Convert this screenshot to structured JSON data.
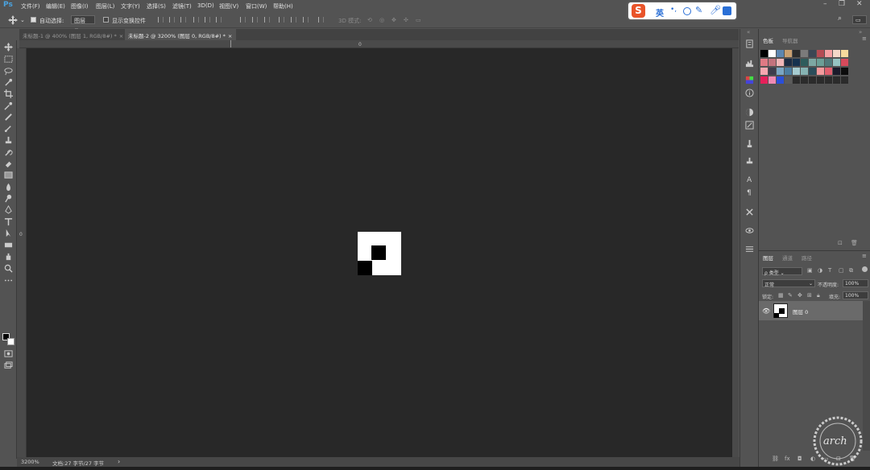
{
  "menubar": {
    "logo": "Ps",
    "items": [
      "文件(F)",
      "编辑(E)",
      "图像(I)",
      "图层(L)",
      "文字(Y)",
      "选择(S)",
      "滤镜(T)",
      "3D(D)",
      "视图(V)",
      "窗口(W)",
      "帮助(H)"
    ]
  },
  "options": {
    "auto_select_label": "自动选择:",
    "auto_select_value": "图层",
    "show_transform_label": "显示变换控件",
    "mode_3d_label": "3D 模式:"
  },
  "ime": {
    "lang": "英",
    "punct": "•,"
  },
  "tabs": [
    {
      "label": "未标题-1 @ 400% (图层 1, RGB/8#) *",
      "close": "×"
    },
    {
      "label": "未标题-2 @ 3200% (图层 0, RGB/8#) *",
      "close": "×"
    }
  ],
  "rulers": {
    "top_zero": "0",
    "left_zero": "0"
  },
  "status": {
    "zoom": "3200%",
    "doc_info": "文档:27 字节/27 字节",
    "arrow": "›"
  },
  "swatches_panel": {
    "tab_swatches": "色板",
    "tab_navigator": "导航器",
    "colors": [
      [
        "#000000",
        "#ffffff",
        "#5d86b0",
        "#c9a071",
        "#2b2b2b",
        "#7b7b7b",
        "#3c4654",
        "#b54b54",
        "#f6a1a4",
        "#f3d8c9",
        "#f6d99c"
      ],
      [
        "#e07a84",
        "#c2737d",
        "#f0b7b8",
        "#1d2d44",
        "#16324f",
        "#2e5c5c",
        "#7da7a3",
        "#6b9e96",
        "#50797a",
        "#96c4c2",
        "#d64a5b"
      ],
      [
        "#f7a8b0",
        "#3d3d4c",
        "#7aa6c2",
        "#4c7ea0",
        "#a5cbd0",
        "#86b3b3",
        "#2b4d5a",
        "#f39a9d",
        "#e05f6e",
        "#1a1a2a",
        "#0c0c0c"
      ],
      [
        "#e6205a",
        "#f08ab4",
        "#2b4fd8",
        "#5b5b5b",
        "#2b2b2b",
        "#2b2b2b",
        "#2b2b2b",
        "#2b2b2b",
        "#2b2b2b",
        "#2b2b2b",
        "#2b2b2b"
      ]
    ]
  },
  "layers_panel": {
    "tab_layers": "图层",
    "tab_channels": "通道",
    "tab_paths": "路径",
    "filter_label": "ρ 类型",
    "blend_mode": "正常",
    "opacity_label": "不透明度:",
    "opacity_value": "100%",
    "lock_label": "锁定:",
    "fill_label": "填充:",
    "fill_value": "100%",
    "layers": [
      {
        "name": "图层 0",
        "visible": true
      }
    ]
  },
  "accent": "#4aa3e0",
  "watermark": {
    "text": "arch 韦达",
    "url": "www.arch.cn"
  }
}
